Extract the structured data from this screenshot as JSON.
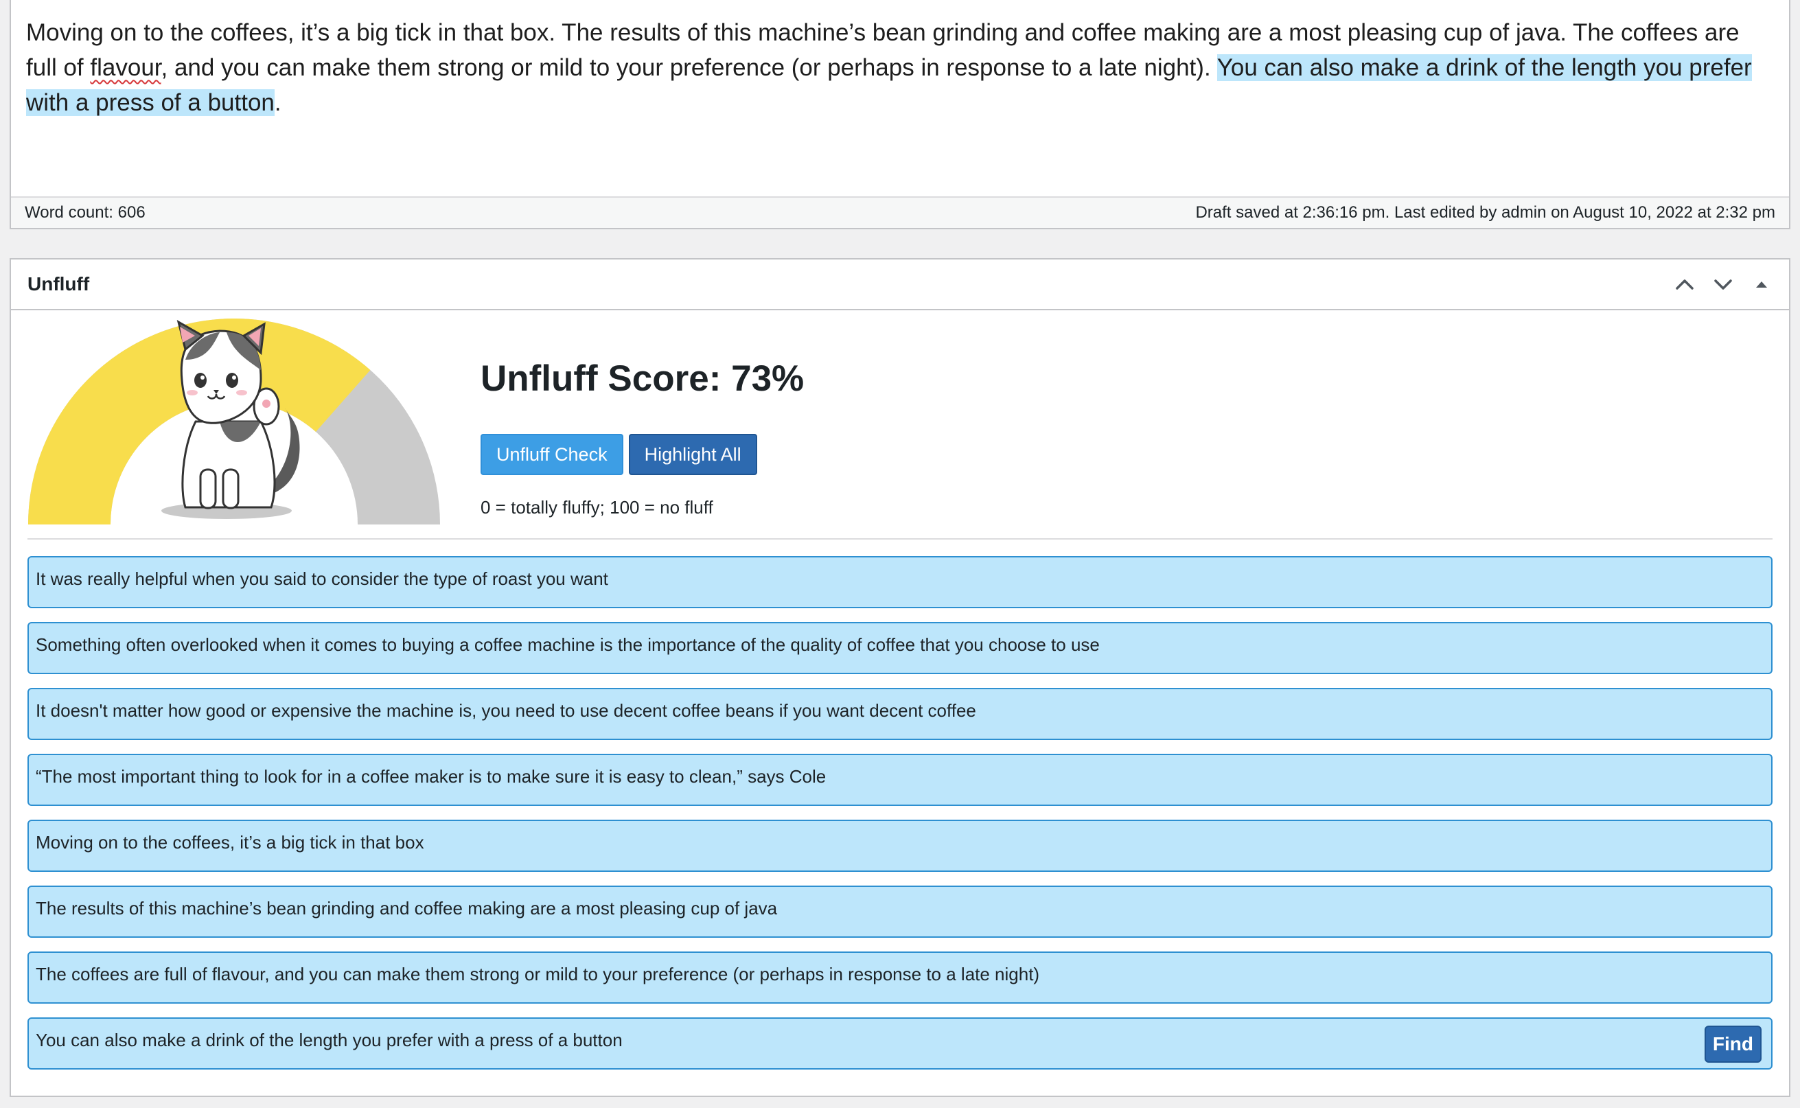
{
  "editor": {
    "text_before": "Moving on to the coffees, it’s a big tick in that box. The results of this machine’s bean grinding and coffee making are a most pleasing cup of java. The coffees are full of ",
    "misspelled": "flavour",
    "text_middle": ", and you can make them strong or mild to your preference (or perhaps in response to a late night). ",
    "selected": "You can also make a drink of the length you prefer with a press of a button",
    "text_after": "."
  },
  "status_bar": {
    "word_count": "Word count: 606",
    "draft_status": "Draft saved at 2:36:16 pm. Last edited by admin on August 10, 2022 at 2:32 pm"
  },
  "panel": {
    "title": "Unfluff",
    "score_title": "Unfluff Score: 73%",
    "score_fraction": 0.73,
    "check_button": "Unfluff Check",
    "highlight_button": "Highlight All",
    "legend": "0 = totally fluffy; 100 = no fluff",
    "find_button": "Find",
    "items": [
      "It was really helpful when you said to consider the type of roast you want",
      "Something often overlooked when it comes to buying a coffee machine is the importance of the quality of coffee that you choose to use",
      "It doesn't matter how good or expensive the machine is, you need to use decent coffee beans if you want decent coffee",
      "“The most important thing to look for in a coffee maker is to make sure it is easy to clean,” says Cole",
      "Moving on to the coffees, it’s a big tick in that box",
      "The results of this machine’s bean grinding and coffee making are a most pleasing cup of java",
      "The coffees are full of flavour, and you can make them strong or mild to your preference (or perhaps in response to a late night)",
      "You can also make a drink of the length you prefer with a press of a button"
    ]
  },
  "colors": {
    "gauge_fill": "#f8dd4c",
    "gauge_track": "#cbcbcb",
    "item_bg": "#bde6fb",
    "item_border": "#2e90d1",
    "button_primary": "#2d6ab0",
    "button_secondary": "#3d9ee5"
  },
  "icons": {
    "move_up": "chevron-up-icon",
    "move_down": "chevron-down-icon",
    "toggle": "triangle-up-icon",
    "mascot": "cat-mascot-icon"
  }
}
